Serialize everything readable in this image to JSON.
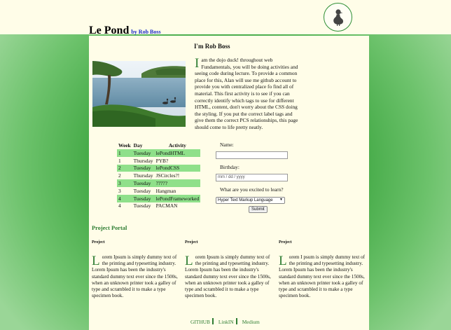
{
  "header": {
    "site_title": "Le Pond",
    "byline": "by Rob Boss"
  },
  "intro": {
    "heading": "I'm Rob Boss",
    "dropcap": "I",
    "text": "am the dojo duck! throughout web Fundamentals, you will be doing activities and seeing code during lecture. To provide a common place for this, Alan will use me github account to provide you with centralized place fo find all of material. This first activity is to see if you can correctly identify which tags to use for different HTML, content, don't worry about the CSS doing the styling. If you put the correct label tags and give them the correct PCS relationships, this page should come to life pretty neatly."
  },
  "schedule": {
    "headers": [
      "Week",
      "Day",
      "Activity"
    ],
    "rows": [
      {
        "week": "1",
        "day": "Tuesday",
        "activity": "lePondHTML",
        "highlight": true
      },
      {
        "week": "1",
        "day": "Thursday",
        "activity": "PYB?",
        "highlight": false
      },
      {
        "week": "2",
        "day": "Tuesday",
        "activity": "lePondCSS",
        "highlight": true
      },
      {
        "week": "2",
        "day": "Thursday",
        "activity": "JSCircles?!",
        "highlight": false
      },
      {
        "week": "3",
        "day": "Tuesday",
        "activity": "?????",
        "highlight": true
      },
      {
        "week": "3",
        "day": "Tuesday",
        "activity": "Hangman",
        "highlight": false
      },
      {
        "week": "4",
        "day": "Tuesday",
        "activity": "lePondFrameworked",
        "highlight": true
      },
      {
        "week": "4",
        "day": "Tuesday",
        "activity": "PACMAN",
        "highlight": false
      }
    ]
  },
  "form": {
    "name_label": "Name:",
    "name_value": "",
    "birthday_label": "Birthday:",
    "birthday_placeholder": "mm / dd / yyyy",
    "excited_label": "What are you excited to learn?",
    "select_value": "Hyper Text Markup Language",
    "submit_label": "Submit"
  },
  "portal": {
    "title": "Project Portal",
    "projects": [
      {
        "title": "Project",
        "dropcap": "L",
        "text": "orem Ipsum is simply dummy text of the printing and typesetting industry. Lorem Ipsum has been the industry's standard dummy text ever since the 1500s, when an unknown printer took a galley of type and scrambled it to make a type specimen book."
      },
      {
        "title": "Project",
        "dropcap": "L",
        "text": "orem Ipsum is simply dummy text of the printing and typesetting industry. Lorem Ipsum has been the industry's standard dummy text ever since the 1500s, when an unknown printer took a galley of type and scrambled it to make a type specimen book."
      },
      {
        "title": "Project",
        "dropcap": "L",
        "text": "orem I psum is simply dummy text of the printing and typesetting industry. Lorem Ipsum has been the industry's standard dummy text ever since the 1500s, when an unknown printer took a galley of type and scrambled it to make a type specimen book."
      }
    ]
  },
  "footer": {
    "links": [
      "GITHUB",
      "LinkIN",
      "Medium"
    ]
  },
  "colors": {
    "accent_green": "#2e7d32",
    "highlight_row": "#8fe08a",
    "page_bg": "#fffde8",
    "byline_blue": "#1a2bc8"
  },
  "icons": {
    "logo": "duck-icon",
    "photo": "lake-with-ducks-image"
  }
}
